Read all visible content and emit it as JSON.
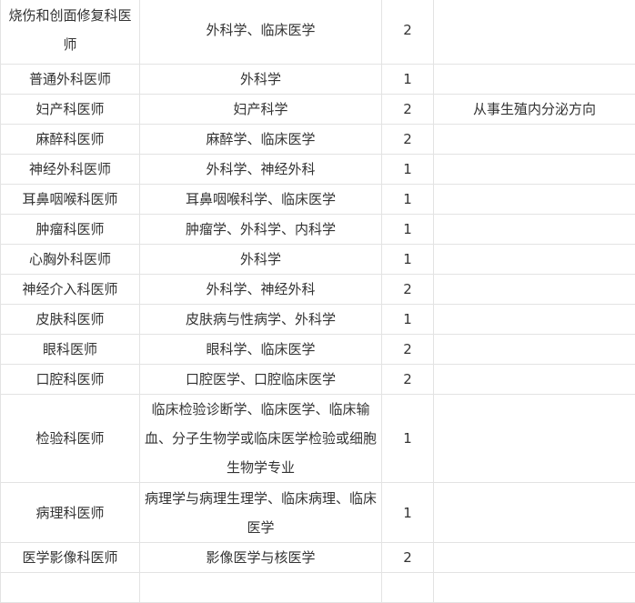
{
  "rows": [
    {
      "dept": "烧伤和创面修复科医师",
      "major": "外科学、临床医学",
      "count": "2",
      "note": ""
    },
    {
      "dept": "普通外科医师",
      "major": "外科学",
      "count": "1",
      "note": ""
    },
    {
      "dept": "妇产科医师",
      "major": "妇产科学",
      "count": "2",
      "note": "从事生殖内分泌方向"
    },
    {
      "dept": "麻醉科医师",
      "major": "麻醉学、临床医学",
      "count": "2",
      "note": ""
    },
    {
      "dept": "神经外科医师",
      "major": "外科学、神经外科",
      "count": "1",
      "note": ""
    },
    {
      "dept": "耳鼻咽喉科医师",
      "major": "耳鼻咽喉科学、临床医学",
      "count": "1",
      "note": ""
    },
    {
      "dept": "肿瘤科医师",
      "major": "肿瘤学、外科学、内科学",
      "count": "1",
      "note": ""
    },
    {
      "dept": "心胸外科医师",
      "major": "外科学",
      "count": "1",
      "note": ""
    },
    {
      "dept": "神经介入科医师",
      "major": "外科学、神经外科",
      "count": "2",
      "note": ""
    },
    {
      "dept": "皮肤科医师",
      "major": "皮肤病与性病学、外科学",
      "count": "1",
      "note": ""
    },
    {
      "dept": "眼科医师",
      "major": "眼科学、临床医学",
      "count": "2",
      "note": ""
    },
    {
      "dept": "口腔科医师",
      "major": "口腔医学、口腔临床医学",
      "count": "2",
      "note": ""
    },
    {
      "dept": "检验科医师",
      "major": "临床检验诊断学、临床医学、临床输血、分子生物学或临床医学检验或细胞生物学专业",
      "count": "1",
      "note": ""
    },
    {
      "dept": "病理科医师",
      "major": "病理学与病理生理学、临床病理、临床医学",
      "count": "1",
      "note": ""
    },
    {
      "dept": "医学影像科医师",
      "major": "影像医学与核医学",
      "count": "2",
      "note": ""
    },
    {
      "dept": "",
      "major": "",
      "count": "",
      "note": ""
    }
  ]
}
